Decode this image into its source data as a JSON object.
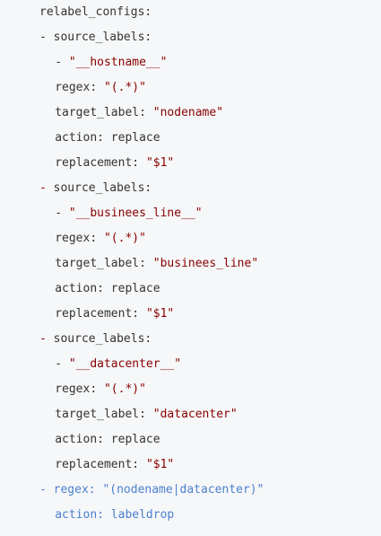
{
  "colors": {
    "background": "#f6f7f8",
    "text": "#333333",
    "string": "#880000",
    "highlight": "#4a7fcf"
  },
  "lines": [
    {
      "kind": "plain",
      "indent": 4,
      "text": "relabel_configs:"
    },
    {
      "kind": "dashed",
      "indent": 4,
      "dash": "- ",
      "dash_style": "plain",
      "text": "source_labels:"
    },
    {
      "kind": "list-string",
      "indent": 6,
      "dash": "- ",
      "value": "\"__hostname__\""
    },
    {
      "kind": "keyvalue",
      "indent": 6,
      "key": "regex: ",
      "value": "\"(.*)\""
    },
    {
      "kind": "keyvalue",
      "indent": 6,
      "key": "target_label: ",
      "value": "\"nodename\""
    },
    {
      "kind": "plain",
      "indent": 6,
      "text": "action: replace"
    },
    {
      "kind": "keyvalue",
      "indent": 6,
      "key": "replacement: ",
      "value": "\"$1\""
    },
    {
      "kind": "dashed",
      "indent": 4,
      "dash": "- ",
      "dash_style": "red",
      "text": "source_labels:"
    },
    {
      "kind": "list-string",
      "indent": 6,
      "dash": "- ",
      "value": "\"__businees_line__\""
    },
    {
      "kind": "keyvalue",
      "indent": 6,
      "key": "regex: ",
      "value": "\"(.*)\""
    },
    {
      "kind": "keyvalue",
      "indent": 6,
      "key": "target_label: ",
      "value": "\"businees_line\""
    },
    {
      "kind": "plain",
      "indent": 6,
      "text": "action: replace"
    },
    {
      "kind": "keyvalue",
      "indent": 6,
      "key": "replacement: ",
      "value": "\"$1\""
    },
    {
      "kind": "dashed",
      "indent": 4,
      "dash": "- ",
      "dash_style": "red",
      "text": "source_labels:"
    },
    {
      "kind": "list-string",
      "indent": 6,
      "dash": "- ",
      "value": "\"__datacenter__\""
    },
    {
      "kind": "keyvalue",
      "indent": 6,
      "key": "regex: ",
      "value": "\"(.*)\""
    },
    {
      "kind": "keyvalue",
      "indent": 6,
      "key": "target_label: ",
      "value": "\"datacenter\""
    },
    {
      "kind": "plain",
      "indent": 6,
      "text": "action: replace"
    },
    {
      "kind": "keyvalue",
      "indent": 6,
      "key": "replacement: ",
      "value": "\"$1\""
    },
    {
      "kind": "blue",
      "indent": 4,
      "text": "- regex: \"(nodename|datacenter)\""
    },
    {
      "kind": "blue",
      "indent": 6,
      "text": "action: labeldrop"
    }
  ]
}
